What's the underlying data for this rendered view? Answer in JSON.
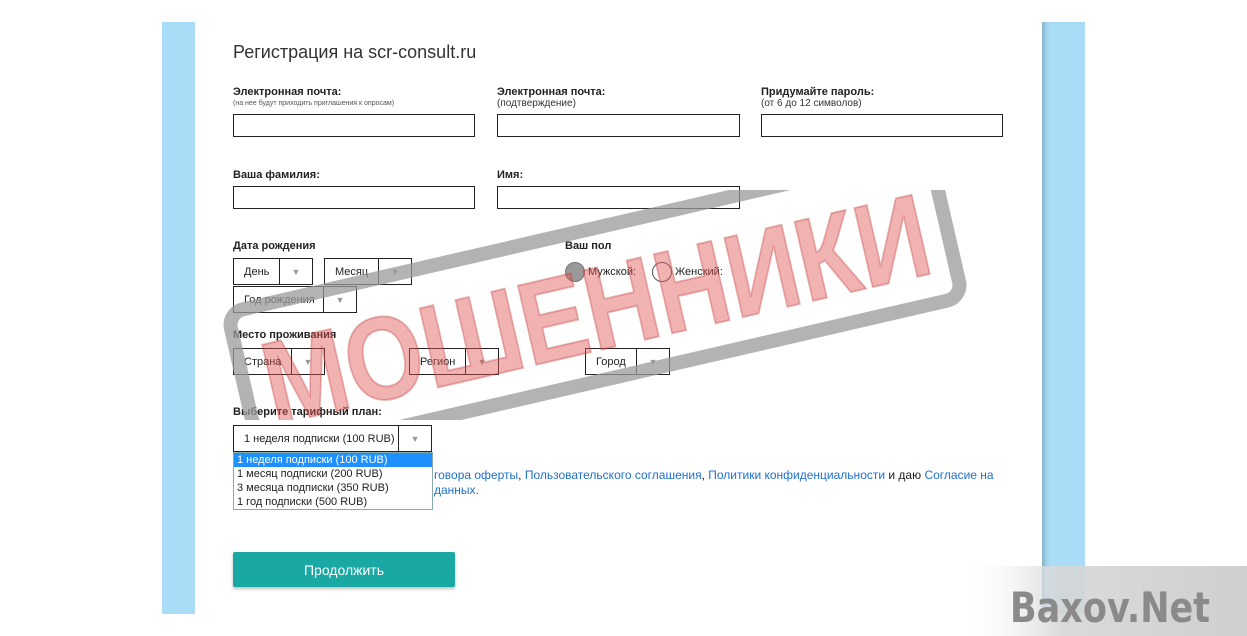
{
  "form": {
    "title": "Регистрация на scr-consult.ru",
    "email_label": "Электронная почта:",
    "email_hint": "(на нее будут приходить приглашения к опросам)",
    "email_confirm_label": "Электронная почта:",
    "email_confirm_hint": "(подтверждение)",
    "password_label": "Придумайте пароль:",
    "password_hint": "(от 6 до 12 символов)",
    "surname_label": "Ваша фамилия:",
    "name_label": "Имя:",
    "birthdate_label": "Дата рождения",
    "day_placeholder": "День",
    "month_placeholder": "Месяц",
    "year_placeholder": "Год рождения",
    "gender_label": "Ваш пол",
    "gender_male": "Мужской:",
    "gender_female": "Женский:",
    "residence_label": "Место проживания",
    "country_placeholder": "Страна",
    "region_placeholder": "Регион",
    "city_placeholder": "Город",
    "plan_label": "Выберите тарифный план:",
    "plan_selected": "1 неделя подписки (100 RUB)",
    "plan_options": [
      "1 неделя подписки (100 RUB)",
      "1 месяц подписки (200 RUB)",
      "3 месяца подписки (350 RUB)",
      "1 год подписки (500 RUB)"
    ],
    "terms_part1": "говора оферты",
    "terms_sep1": ", ",
    "terms_link2": "Пользовательского соглашения",
    "terms_sep2": ", ",
    "terms_link3": "Политики конфиденциальности",
    "terms_mid": " и даю ",
    "terms_link4": "Согласие на",
    "terms_line2": "данных.",
    "continue_button": "Продолжить"
  },
  "overlays": {
    "stamp_text": "МОШЕННИКИ",
    "watermark_text": "Baxov.Net"
  },
  "colors": {
    "side": "#a9dcf6",
    "button": "#1aa8a4",
    "link": "#1e6fd0",
    "stamp": "#e05555"
  }
}
